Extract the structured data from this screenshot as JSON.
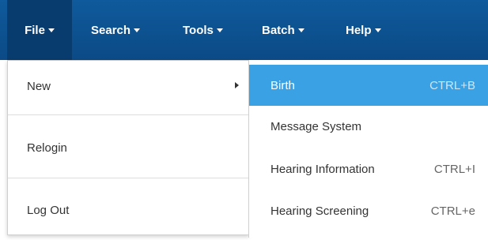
{
  "navbar": {
    "items": [
      {
        "label": "File"
      },
      {
        "label": "Search"
      },
      {
        "label": "Tools"
      },
      {
        "label": "Batch"
      },
      {
        "label": "Help"
      }
    ]
  },
  "file_menu": {
    "items": [
      {
        "label": "New"
      },
      {
        "label": "Relogin"
      },
      {
        "label": "Log Out"
      }
    ]
  },
  "new_submenu": {
    "items": [
      {
        "label": "Birth",
        "shortcut": "CTRL+B",
        "highlighted": true
      },
      {
        "label": "Message System",
        "shortcut": ""
      },
      {
        "label": "Hearing Information",
        "shortcut": "CTRL+I"
      },
      {
        "label": "Hearing Screening",
        "shortcut": "CTRL+e"
      }
    ]
  },
  "colors": {
    "navbar": "#0b4a86",
    "active_nav": "#093c6e",
    "highlight": "#3aa2e4"
  },
  "icons": {
    "nav_dropdown": "caret-down-icon",
    "submenu_indicator": "caret-right-icon"
  }
}
